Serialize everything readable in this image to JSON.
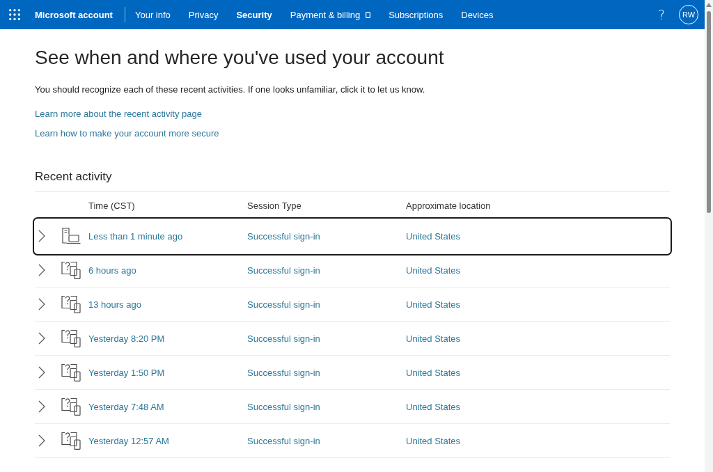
{
  "top_bar": {
    "brand": "Microsoft account",
    "nav_items": [
      {
        "label": "Your info",
        "selected": false,
        "external": false
      },
      {
        "label": "Privacy",
        "selected": false,
        "external": false
      },
      {
        "label": "Security",
        "selected": true,
        "external": false
      },
      {
        "label": "Payment & billing",
        "selected": false,
        "external": true
      },
      {
        "label": "Subscriptions",
        "selected": false,
        "external": false
      },
      {
        "label": "Devices",
        "selected": false,
        "external": false
      }
    ],
    "help_button": "?",
    "avatar_initials": "RW"
  },
  "page": {
    "title": "See when and where you've used your account",
    "intro": "You should recognize each of these recent activities. If one looks unfamiliar, click it to let us know.",
    "links": [
      "Learn more about the recent activity page",
      "Learn how to make your account more secure"
    ]
  },
  "recent_activity": {
    "title": "Recent activity",
    "columns": [
      "Time (CST)",
      "Session Type",
      "Approximate location"
    ],
    "rows": [
      {
        "kind": "computer",
        "time": "Less than 1 minute ago",
        "session_type": "Successful sign-in",
        "location": "United States",
        "selected": true,
        "expanded": false
      },
      {
        "kind": "unknown",
        "time": "6 hours ago",
        "session_type": "Successful sign-in",
        "location": "United States",
        "selected": false,
        "expanded": false
      },
      {
        "kind": "unknown",
        "time": "13 hours ago",
        "session_type": "Successful sign-in",
        "location": "United States",
        "selected": false,
        "expanded": false
      },
      {
        "kind": "unknown",
        "time": "Yesterday 8:20 PM",
        "session_type": "Successful sign-in",
        "location": "United States",
        "selected": false,
        "expanded": false
      },
      {
        "kind": "unknown",
        "time": "Yesterday 1:50 PM",
        "session_type": "Successful sign-in",
        "location": "United States",
        "selected": false,
        "expanded": false
      },
      {
        "kind": "unknown",
        "time": "Yesterday 7:48 AM",
        "session_type": "Successful sign-in",
        "location": "United States",
        "selected": false,
        "expanded": false
      },
      {
        "kind": "unknown",
        "time": "Yesterday 12:57 AM",
        "session_type": "Successful sign-in",
        "location": "United States",
        "selected": false,
        "expanded": false
      }
    ]
  }
}
